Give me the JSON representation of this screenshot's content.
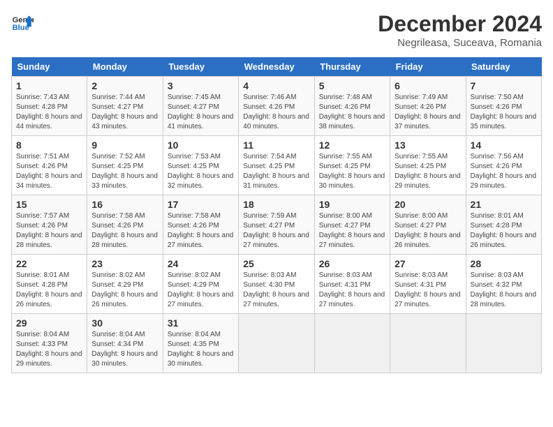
{
  "logo": {
    "line1": "General",
    "line2": "Blue"
  },
  "title": "December 2024",
  "subtitle": "Negrileasa, Suceava, Romania",
  "days_of_week": [
    "Sunday",
    "Monday",
    "Tuesday",
    "Wednesday",
    "Thursday",
    "Friday",
    "Saturday"
  ],
  "weeks": [
    [
      {
        "day": "1",
        "sunrise": "7:43 AM",
        "sunset": "4:28 PM",
        "daylight": "8 hours and 44 minutes."
      },
      {
        "day": "2",
        "sunrise": "7:44 AM",
        "sunset": "4:27 PM",
        "daylight": "8 hours and 43 minutes."
      },
      {
        "day": "3",
        "sunrise": "7:45 AM",
        "sunset": "4:27 PM",
        "daylight": "8 hours and 41 minutes."
      },
      {
        "day": "4",
        "sunrise": "7:46 AM",
        "sunset": "4:26 PM",
        "daylight": "8 hours and 40 minutes."
      },
      {
        "day": "5",
        "sunrise": "7:48 AM",
        "sunset": "4:26 PM",
        "daylight": "8 hours and 38 minutes."
      },
      {
        "day": "6",
        "sunrise": "7:49 AM",
        "sunset": "4:26 PM",
        "daylight": "8 hours and 37 minutes."
      },
      {
        "day": "7",
        "sunrise": "7:50 AM",
        "sunset": "4:26 PM",
        "daylight": "8 hours and 35 minutes."
      }
    ],
    [
      {
        "day": "8",
        "sunrise": "7:51 AM",
        "sunset": "4:26 PM",
        "daylight": "8 hours and 34 minutes."
      },
      {
        "day": "9",
        "sunrise": "7:52 AM",
        "sunset": "4:25 PM",
        "daylight": "8 hours and 33 minutes."
      },
      {
        "day": "10",
        "sunrise": "7:53 AM",
        "sunset": "4:25 PM",
        "daylight": "8 hours and 32 minutes."
      },
      {
        "day": "11",
        "sunrise": "7:54 AM",
        "sunset": "4:25 PM",
        "daylight": "8 hours and 31 minutes."
      },
      {
        "day": "12",
        "sunrise": "7:55 AM",
        "sunset": "4:25 PM",
        "daylight": "8 hours and 30 minutes."
      },
      {
        "day": "13",
        "sunrise": "7:55 AM",
        "sunset": "4:25 PM",
        "daylight": "8 hours and 29 minutes."
      },
      {
        "day": "14",
        "sunrise": "7:56 AM",
        "sunset": "4:26 PM",
        "daylight": "8 hours and 29 minutes."
      }
    ],
    [
      {
        "day": "15",
        "sunrise": "7:57 AM",
        "sunset": "4:26 PM",
        "daylight": "8 hours and 28 minutes."
      },
      {
        "day": "16",
        "sunrise": "7:58 AM",
        "sunset": "4:26 PM",
        "daylight": "8 hours and 28 minutes."
      },
      {
        "day": "17",
        "sunrise": "7:58 AM",
        "sunset": "4:26 PM",
        "daylight": "8 hours and 27 minutes."
      },
      {
        "day": "18",
        "sunrise": "7:59 AM",
        "sunset": "4:27 PM",
        "daylight": "8 hours and 27 minutes."
      },
      {
        "day": "19",
        "sunrise": "8:00 AM",
        "sunset": "4:27 PM",
        "daylight": "8 hours and 27 minutes."
      },
      {
        "day": "20",
        "sunrise": "8:00 AM",
        "sunset": "4:27 PM",
        "daylight": "8 hours and 26 minutes."
      },
      {
        "day": "21",
        "sunrise": "8:01 AM",
        "sunset": "4:28 PM",
        "daylight": "8 hours and 26 minutes."
      }
    ],
    [
      {
        "day": "22",
        "sunrise": "8:01 AM",
        "sunset": "4:28 PM",
        "daylight": "8 hours and 26 minutes."
      },
      {
        "day": "23",
        "sunrise": "8:02 AM",
        "sunset": "4:29 PM",
        "daylight": "8 hours and 26 minutes."
      },
      {
        "day": "24",
        "sunrise": "8:02 AM",
        "sunset": "4:29 PM",
        "daylight": "8 hours and 27 minutes."
      },
      {
        "day": "25",
        "sunrise": "8:03 AM",
        "sunset": "4:30 PM",
        "daylight": "8 hours and 27 minutes."
      },
      {
        "day": "26",
        "sunrise": "8:03 AM",
        "sunset": "4:31 PM",
        "daylight": "8 hours and 27 minutes."
      },
      {
        "day": "27",
        "sunrise": "8:03 AM",
        "sunset": "4:31 PM",
        "daylight": "8 hours and 27 minutes."
      },
      {
        "day": "28",
        "sunrise": "8:03 AM",
        "sunset": "4:32 PM",
        "daylight": "8 hours and 28 minutes."
      }
    ],
    [
      {
        "day": "29",
        "sunrise": "8:04 AM",
        "sunset": "4:33 PM",
        "daylight": "8 hours and 29 minutes."
      },
      {
        "day": "30",
        "sunrise": "8:04 AM",
        "sunset": "4:34 PM",
        "daylight": "8 hours and 30 minutes."
      },
      {
        "day": "31",
        "sunrise": "8:04 AM",
        "sunset": "4:35 PM",
        "daylight": "8 hours and 30 minutes."
      },
      null,
      null,
      null,
      null
    ]
  ],
  "labels": {
    "sunrise": "Sunrise:",
    "sunset": "Sunset:",
    "daylight": "Daylight:"
  }
}
